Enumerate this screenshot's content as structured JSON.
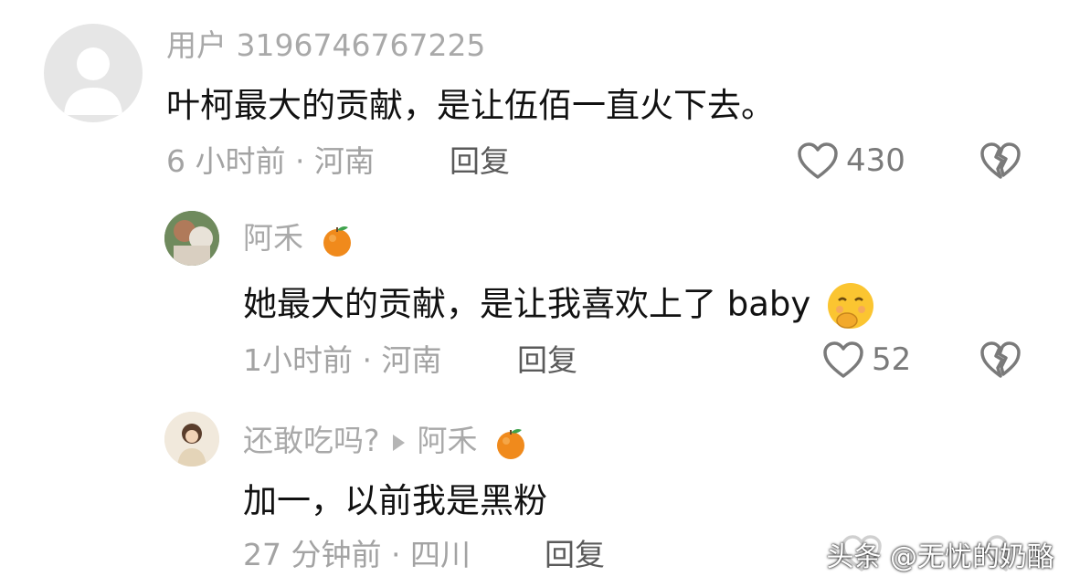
{
  "comments": [
    {
      "username": "用户 3196746767225",
      "text": "叶柯最大的贡献，是让伍佰一直火下去。",
      "time_location": "6 小时前 · 河南",
      "reply_label": "回复",
      "likes": "430"
    },
    {
      "username": "阿禾",
      "text": "她最大的贡献，是让我喜欢上了 baby",
      "time_location": "1小时前 · 河南",
      "reply_label": "回复",
      "likes": "52"
    },
    {
      "username": "还敢吃吗?",
      "reply_to": "阿禾",
      "text": "加一，以前我是黑粉",
      "time_location": "27 分钟前 · 四川",
      "reply_label": "回复"
    }
  ],
  "watermark": "头条 @无忧的奶酪",
  "colors": {
    "primary_text": "#111111",
    "secondary_text": "#a9a9a9",
    "icon": "#7a7a7a"
  },
  "icons": [
    "user-placeholder-icon",
    "heart-icon",
    "broken-heart-icon",
    "orange-emoji-icon",
    "shy-face-emoji-icon",
    "reply-arrow-icon"
  ]
}
